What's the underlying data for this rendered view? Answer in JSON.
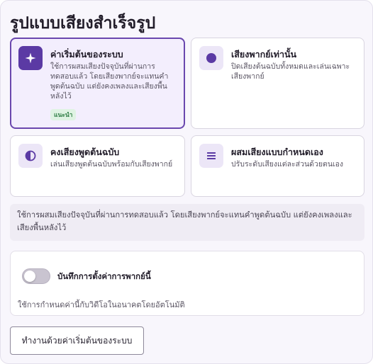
{
  "title": "รูปแบบเสียงสำเร็จรูป",
  "options": [
    {
      "id": "system-default",
      "title": "ค่าเริ่มต้นของระบบ",
      "description": "ใช้การผสมเสียงปัจจุบันที่ผ่านการทดสอบแล้ว โดยเสียงพากย์จะแทนคำพูดต้นฉบับ แต่ยังคงเพลงและเสียงพื้นหลังไว้",
      "badge": "แนะนำ",
      "icon": "sparkle-icon",
      "selected": true
    },
    {
      "id": "dub-only",
      "title": "เสียงพากย์เท่านั้น",
      "description": "ปิดเสียงต้นฉบับทั้งหมดและเล่นเฉพาะเสียงพากย์",
      "icon": "circle-icon",
      "selected": false
    },
    {
      "id": "keep-original",
      "title": "คงเสียงพูดต้นฉบับ",
      "description": "เล่นเสียงพูดต้นฉบับพร้อมกับเสียงพากย์",
      "icon": "half-circle-icon",
      "selected": false
    },
    {
      "id": "custom-mix",
      "title": "ผสมเสียงแบบกำหนดเอง",
      "description": "ปรับระดับเสียงแต่ละส่วนด้วยตนเอง",
      "icon": "list-icon",
      "selected": false
    }
  ],
  "info_text": "ใช้การผสมเสียงปัจจุบันที่ผ่านการทดสอบแล้ว โดยเสียงพากย์จะแทนคำพูดต้นฉบับ แต่ยังคงเพลงและเสียงพื้นหลังไว้",
  "settings": {
    "toggle_label": "บันทึกการตั้งค่าการพากย์นี้",
    "toggle_on": false,
    "help_text": "ใช้การกำหนดค่านี้กับวิดีโอในอนาคตโดยอัตโนมัติ"
  },
  "reset_button_label": "ทำงานด้วยค่าเริ่มต้นของระบบ",
  "colors": {
    "accent": "#5b3aa4",
    "selected_border": "#6a47ae",
    "badge_bg": "#dff3e3",
    "badge_text": "#2e7d44"
  }
}
